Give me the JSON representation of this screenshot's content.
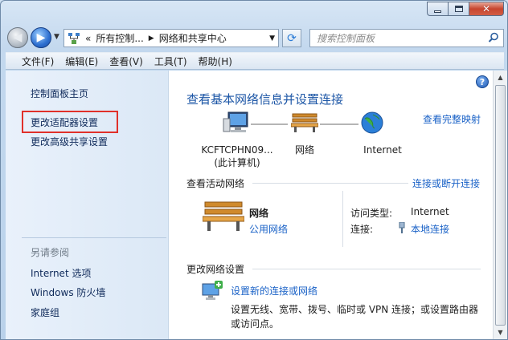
{
  "address_bar": {
    "crumbs": [
      "«",
      "所有控制...",
      "网络和共享中心"
    ],
    "search_placeholder": "搜索控制面板"
  },
  "menu": [
    "文件(F)",
    "编辑(E)",
    "查看(V)",
    "工具(T)",
    "帮助(H)"
  ],
  "sidebar": {
    "links": [
      {
        "label": "控制面板主页"
      },
      {
        "label": "更改适配器设置",
        "highlighted": true
      },
      {
        "label": "更改高级共享设置"
      }
    ],
    "see_also_heading": "另请参阅",
    "see_also": [
      "Internet 选项",
      "Windows 防火墙",
      "家庭组"
    ]
  },
  "main": {
    "title": "查看基本网络信息并设置连接",
    "view_full_map": "查看完整映射",
    "map_nodes": [
      {
        "label": "KCFTCPHN09...",
        "sublabel": "(此计算机)",
        "icon": "computer-icon"
      },
      {
        "label": "网络",
        "icon": "bench-icon"
      },
      {
        "label": "Internet",
        "icon": "globe-icon"
      }
    ],
    "active_networks_heading": "查看活动网络",
    "connect_disconnect_link": "连接或断开连接",
    "active_network": {
      "name": "网络",
      "type_link": "公用网络",
      "access_type_label": "访问类型:",
      "access_type_value": "Internet",
      "connection_label": "连接:",
      "connection_value": "本地连接"
    },
    "change_settings_heading": "更改网络设置",
    "setup_link": "设置新的连接或网络",
    "setup_desc_line1": "设置无线、宽带、拨号、临时或 VPN 连接；或设置路由器",
    "setup_desc_line2": "或访问点。"
  },
  "colors": {
    "link": "#1a62c7",
    "title": "#1c56a6",
    "highlight_box": "#e0302a"
  }
}
